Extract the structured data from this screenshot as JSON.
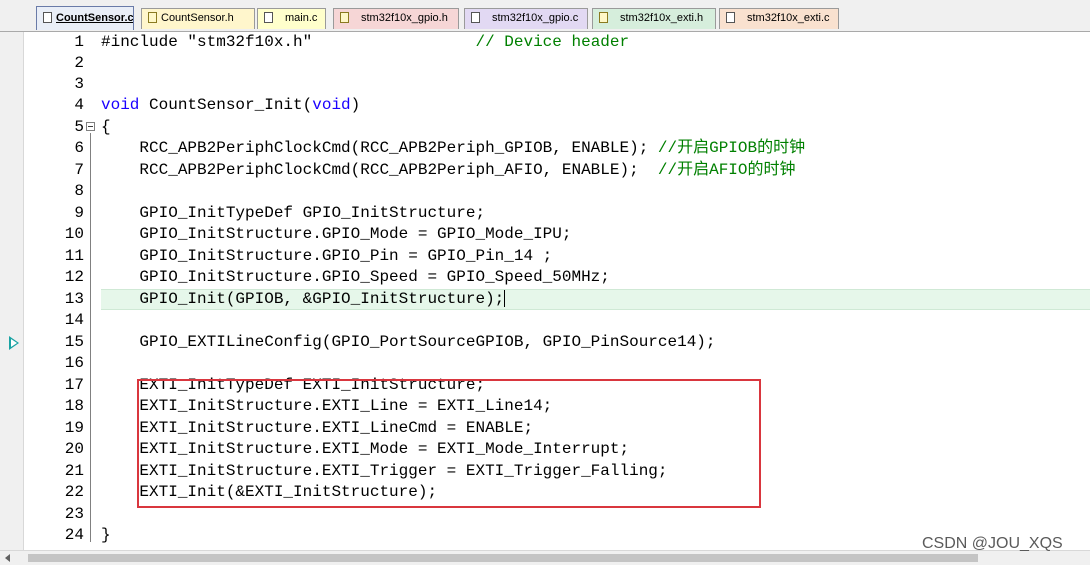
{
  "tabs": [
    {
      "label": "CountSensor.c",
      "type": "c",
      "active": true,
      "color": "#e9eef7"
    },
    {
      "label": "CountSensor.h",
      "type": "h",
      "active": false,
      "color": "#fff6cc"
    },
    {
      "label": "main.c",
      "type": "c",
      "active": false,
      "color": "#ffffcc"
    },
    {
      "label": "stm32f10x_gpio.h",
      "type": "h",
      "active": false,
      "color": "#f6d6d6"
    },
    {
      "label": "stm32f10x_gpio.c",
      "type": "c",
      "active": false,
      "color": "#e2d9f3"
    },
    {
      "label": "stm32f10x_exti.h",
      "type": "h",
      "active": false,
      "color": "#d6eedc"
    },
    {
      "label": "stm32f10x_exti.c",
      "type": "c",
      "active": false,
      "color": "#f9e1cf"
    }
  ],
  "lines": [
    {
      "n": "1",
      "text": "#include \"stm32f10x.h\"                 // Device header"
    },
    {
      "n": "2",
      "text": ""
    },
    {
      "n": "3",
      "text": ""
    },
    {
      "n": "4",
      "text": "void CountSensor_Init(void)"
    },
    {
      "n": "5",
      "text": "{"
    },
    {
      "n": "6",
      "text": "    RCC_APB2PeriphClockCmd(RCC_APB2Periph_GPIOB, ENABLE); //开启GPIOB的时钟"
    },
    {
      "n": "7",
      "text": "    RCC_APB2PeriphClockCmd(RCC_APB2Periph_AFIO, ENABLE);  //开启AFIO的时钟"
    },
    {
      "n": "8",
      "text": ""
    },
    {
      "n": "9",
      "text": "    GPIO_InitTypeDef GPIO_InitStructure;"
    },
    {
      "n": "10",
      "text": "    GPIO_InitStructure.GPIO_Mode = GPIO_Mode_IPU;"
    },
    {
      "n": "11",
      "text": "    GPIO_InitStructure.GPIO_Pin = GPIO_Pin_14 ;"
    },
    {
      "n": "12",
      "text": "    GPIO_InitStructure.GPIO_Speed = GPIO_Speed_50MHz;"
    },
    {
      "n": "13",
      "text": "    GPIO_Init(GPIOB, &GPIO_InitStructure);"
    },
    {
      "n": "14",
      "text": ""
    },
    {
      "n": "15",
      "text": "    GPIO_EXTILineConfig(GPIO_PortSourceGPIOB, GPIO_PinSource14);"
    },
    {
      "n": "16",
      "text": ""
    },
    {
      "n": "17",
      "text": "    EXTI_InitTypeDef EXTI_InitStructure;"
    },
    {
      "n": "18",
      "text": "    EXTI_InitStructure.EXTI_Line = EXTI_Line14;"
    },
    {
      "n": "19",
      "text": "    EXTI_InitStructure.EXTI_LineCmd = ENABLE;"
    },
    {
      "n": "20",
      "text": "    EXTI_InitStructure.EXTI_Mode = EXTI_Mode_Interrupt;"
    },
    {
      "n": "21",
      "text": "    EXTI_InitStructure.EXTI_Trigger = EXTI_Trigger_Falling;"
    },
    {
      "n": "22",
      "text": "    EXTI_Init(&EXTI_InitStructure);"
    },
    {
      "n": "23",
      "text": ""
    },
    {
      "n": "24",
      "text": "}"
    }
  ],
  "editor": {
    "current_line": "13",
    "execution_arrow_line": "15",
    "fold_marker_line": "5",
    "highlight_color": "#e6f7ea",
    "annotation_box_color": "#d9363e"
  },
  "watermark": "CSDN @JOU_XQS"
}
